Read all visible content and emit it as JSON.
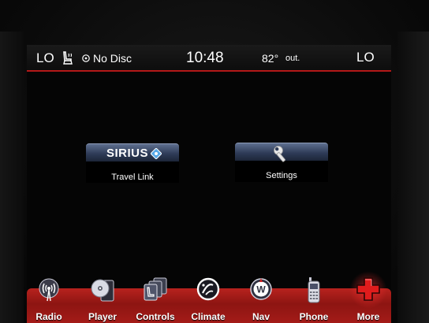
{
  "status_bar": {
    "left_temp_setting": "LO",
    "media_status": "No Disc",
    "clock": "10:48",
    "outside_temp": "82°",
    "outside_temp_unit": "out.",
    "right_temp_setting": "LO"
  },
  "apps": [
    {
      "logo_text": "SIRIUS",
      "label": "Travel Link",
      "icon": "sirius-logo-icon"
    },
    {
      "label": "Settings",
      "icon": "wrench-icon"
    }
  ],
  "nav": [
    {
      "label": "Radio",
      "icon": "radio-tower-icon"
    },
    {
      "label": "Player",
      "icon": "disc-player-icon"
    },
    {
      "label": "Controls",
      "icon": "seat-controls-icon"
    },
    {
      "label": "Climate",
      "icon": "climate-icon"
    },
    {
      "label": "Nav",
      "icon": "compass-icon"
    },
    {
      "label": "Phone",
      "icon": "phone-icon"
    },
    {
      "label": "More",
      "icon": "plus-icon"
    }
  ],
  "colors": {
    "accent_red": "#b41818",
    "tile_blue": "#2f3c58"
  }
}
